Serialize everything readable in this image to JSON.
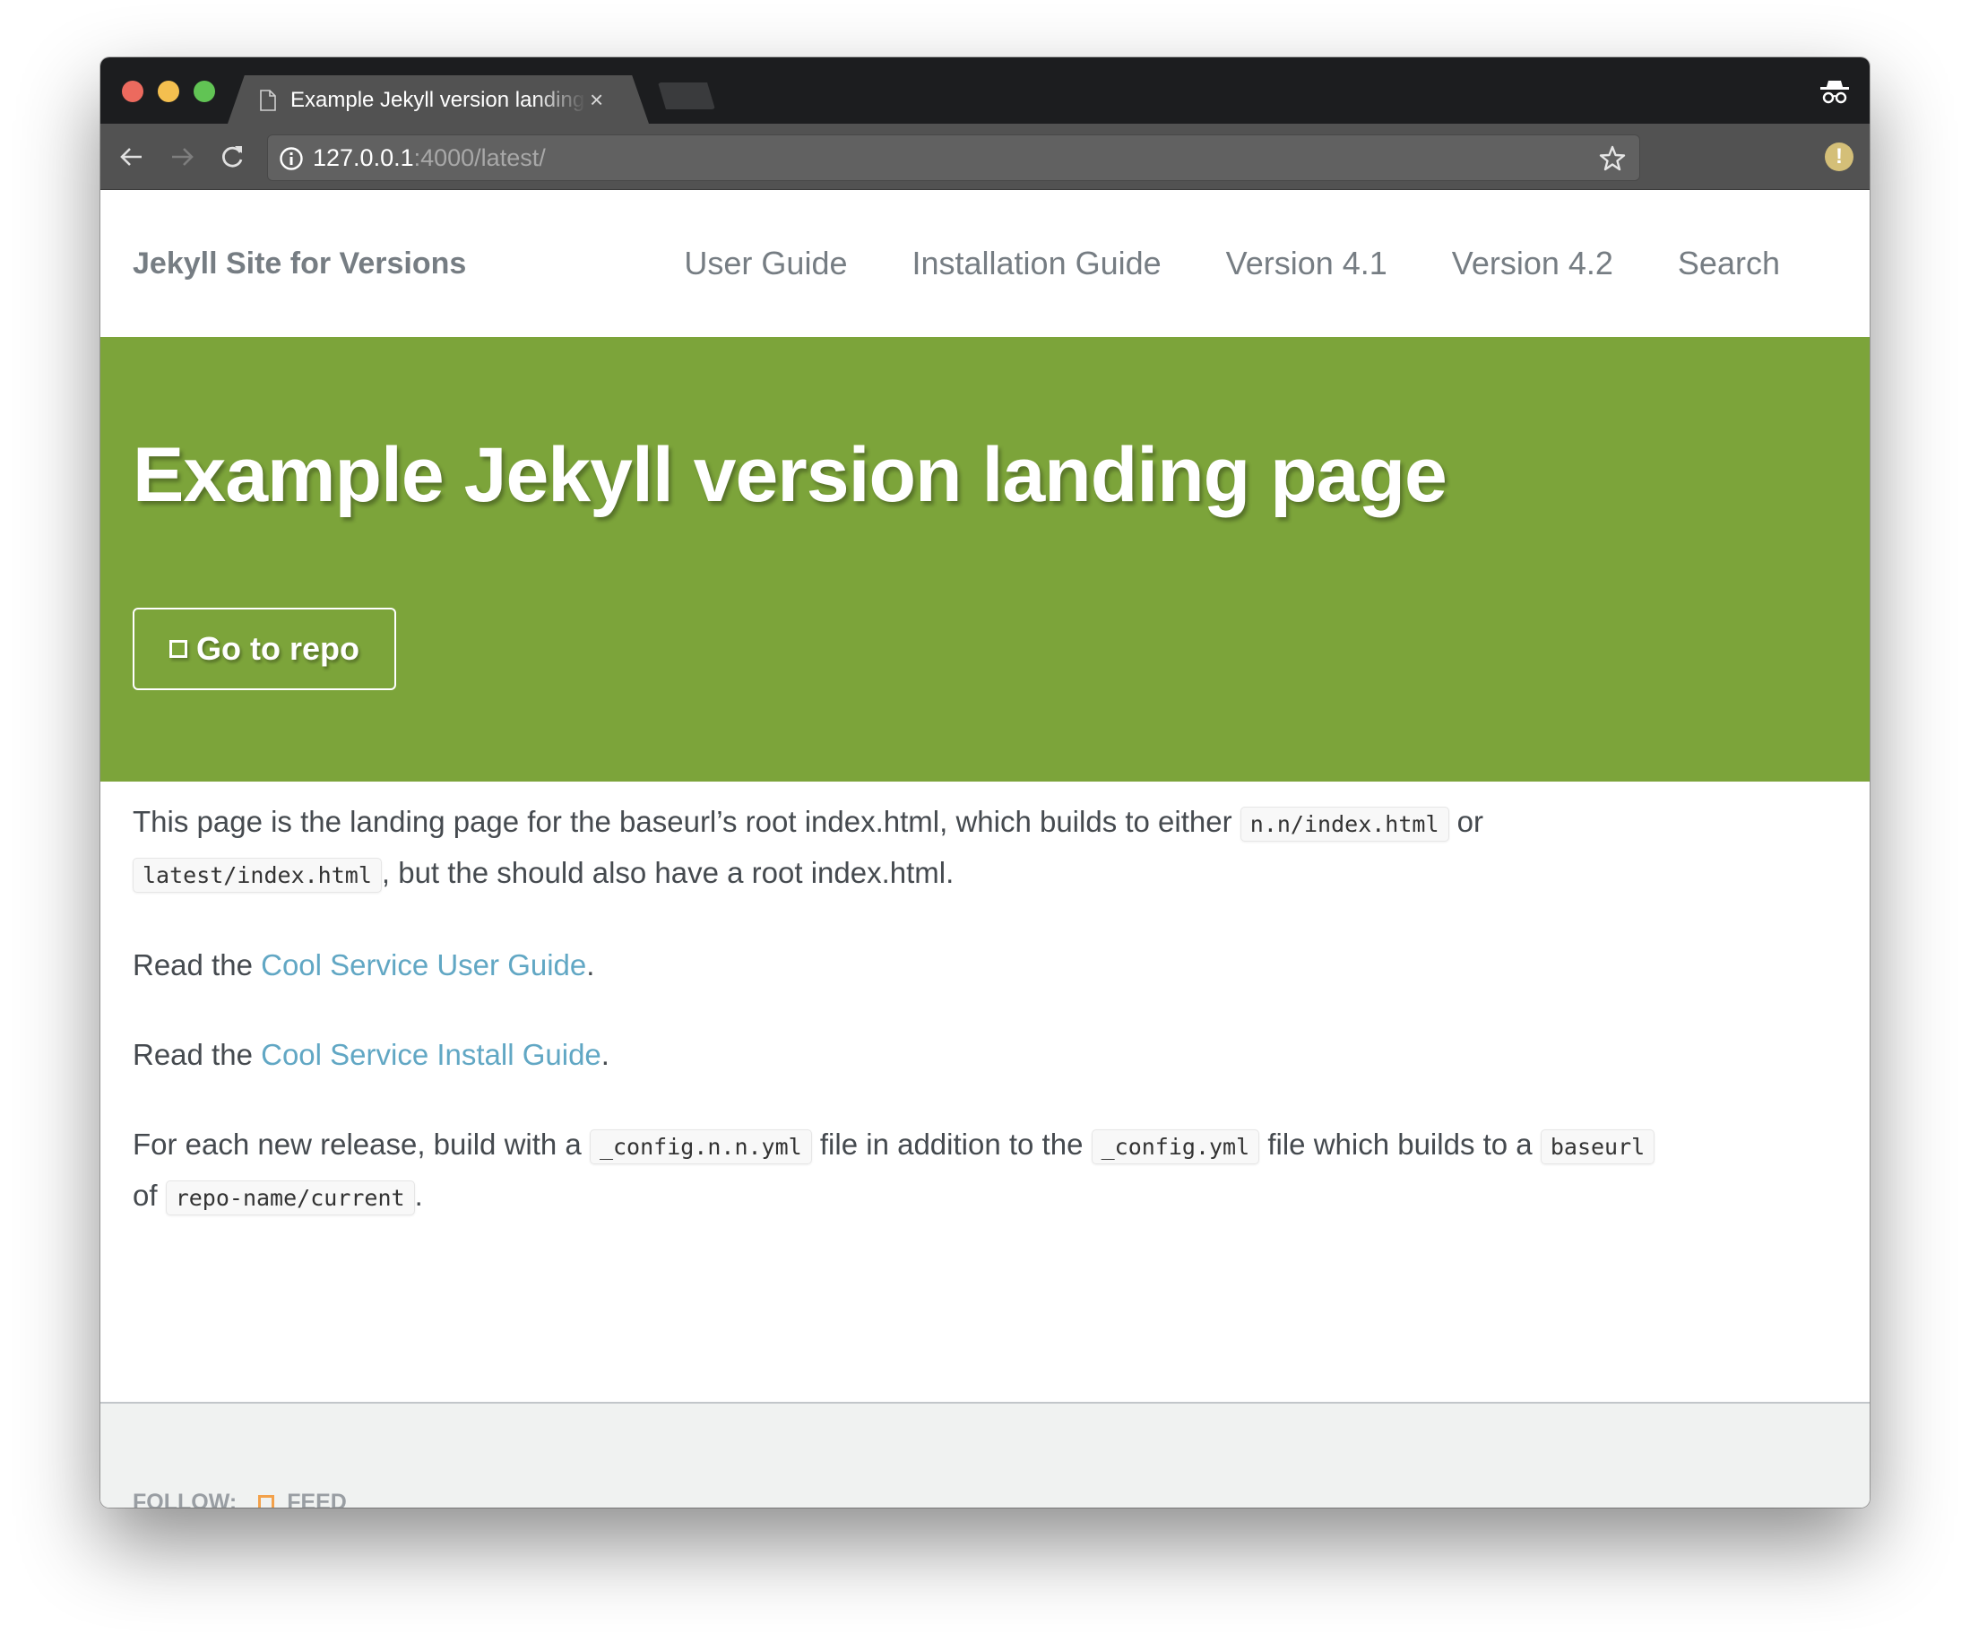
{
  "browser": {
    "tab_title": "Example Jekyll version landing page",
    "tab_close_glyph": "×",
    "url_host": "127.0.0.1",
    "url_rest": ":4000/latest/",
    "alert_glyph": "!"
  },
  "nav": {
    "brand": "Jekyll Site for Versions",
    "items": [
      {
        "label": "User Guide"
      },
      {
        "label": "Installation Guide"
      },
      {
        "label": "Version 4.1"
      },
      {
        "label": "Version 4.2"
      },
      {
        "label": "Search"
      }
    ]
  },
  "hero": {
    "title": "Example Jekyll version landing page",
    "button_label": "Go to repo",
    "background_color": "#7ca43a"
  },
  "content": {
    "p1": {
      "text1": "This page is the landing page for the baseurl’s root index.html, which builds to either ",
      "code1": "n.n/index.html",
      "text2": " or ",
      "code2": "latest/index.html",
      "text3": ", but the should also have a root index.html."
    },
    "p2": {
      "prefix": "Read the ",
      "link": "Cool Service User Guide",
      "suffix": "."
    },
    "p3": {
      "prefix": "Read the ",
      "link": "Cool Service Install Guide",
      "suffix": "."
    },
    "p4": {
      "text1": "For each new release, build with a ",
      "code1": "_config.n.n.yml",
      "text2": " file in addition to the ",
      "code2": "_config.yml",
      "text3": " file which builds to a ",
      "code3": "baseurl",
      "text4": " of ",
      "code4": "repo-name/current",
      "text5": "."
    },
    "link_color": "#61a7c4"
  },
  "footer": {
    "follow_label": "FOLLOW:",
    "feed_label": "FEED",
    "feed_icon_color": "#f3a14a"
  }
}
